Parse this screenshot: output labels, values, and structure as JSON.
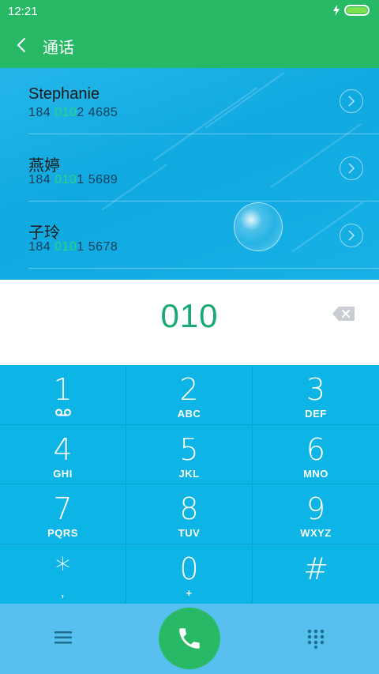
{
  "status": {
    "time": "12:21"
  },
  "header": {
    "title": "通话"
  },
  "suggestions": [
    {
      "name": "Stephanie",
      "number_prefix": "184 ",
      "number_match": "010",
      "number_suffix": "2 4685"
    },
    {
      "name": "燕婷",
      "number_prefix": "184 ",
      "number_match": "010",
      "number_suffix": "1 5689"
    },
    {
      "name": "子玲",
      "number_prefix": "184 ",
      "number_match": "010",
      "number_suffix": "1 5678"
    }
  ],
  "display": {
    "value": "010"
  },
  "keypad": [
    {
      "digit": "1",
      "letters": ""
    },
    {
      "digit": "2",
      "letters": "ABC"
    },
    {
      "digit": "3",
      "letters": "DEF"
    },
    {
      "digit": "4",
      "letters": "GHI"
    },
    {
      "digit": "5",
      "letters": "JKL"
    },
    {
      "digit": "6",
      "letters": "MNO"
    },
    {
      "digit": "7",
      "letters": "PQRS"
    },
    {
      "digit": "8",
      "letters": "TUV"
    },
    {
      "digit": "9",
      "letters": "WXYZ"
    },
    {
      "digit": "*",
      "letters": ","
    },
    {
      "digit": "0",
      "letters": "+"
    },
    {
      "digit": "#",
      "letters": ""
    }
  ],
  "icons": {
    "back": "chevron-left-icon",
    "backspace": "backspace-icon",
    "voicemail": "voicemail-icon",
    "menu": "menu-icon",
    "call": "phone-icon",
    "dialpad": "dialpad-icon"
  },
  "colors": {
    "accent": "#28b967",
    "match": "#2fd47e",
    "keypad_bg": "#0db4e6",
    "display_text": "#1aa972"
  }
}
